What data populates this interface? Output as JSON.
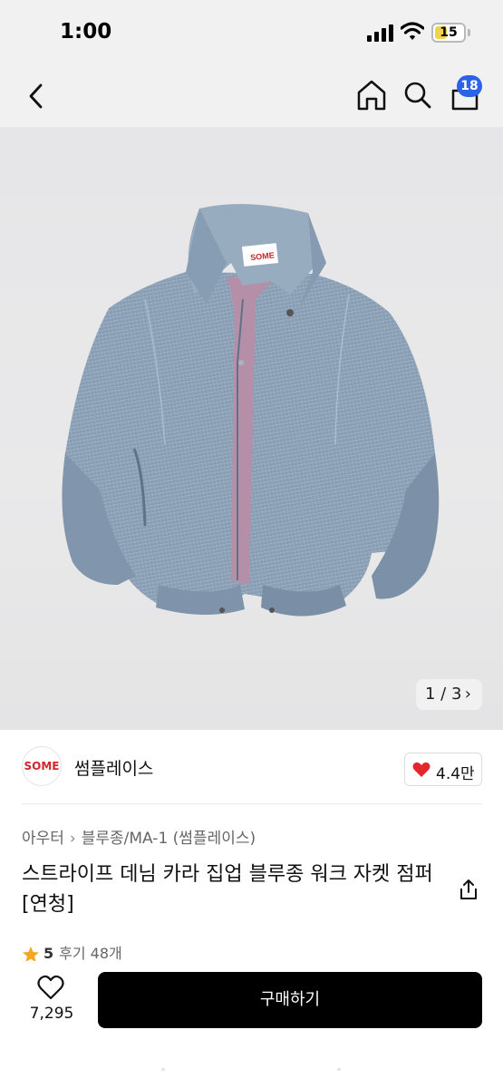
{
  "status": {
    "time": "1:00",
    "battery": "15",
    "battery_level": 0.15
  },
  "header": {
    "icons": [
      "back-icon",
      "home-icon",
      "search-icon",
      "cart-icon"
    ],
    "cart_badge": "18",
    "badge_color": "#2a63e8"
  },
  "image": {
    "counter": "1 / 3",
    "logo_label": "SOME",
    "description_icon": "denim-jacket-image"
  },
  "store": {
    "logo_text": "SOME",
    "name": "썸플레이스",
    "likes": "4.4만",
    "heart_color": "#e5262d"
  },
  "product": {
    "breadcrumb": [
      "아우터",
      "블루종/MA-1 (썸플레이스)"
    ],
    "title": "스트라이프 데님 카라 집업 블루종 워크 자켓 점퍼 [연청]",
    "rating": "5",
    "reviews": "후기 48개"
  },
  "bottom": {
    "wish_count": "7,295",
    "buy_label": "구매하기"
  }
}
